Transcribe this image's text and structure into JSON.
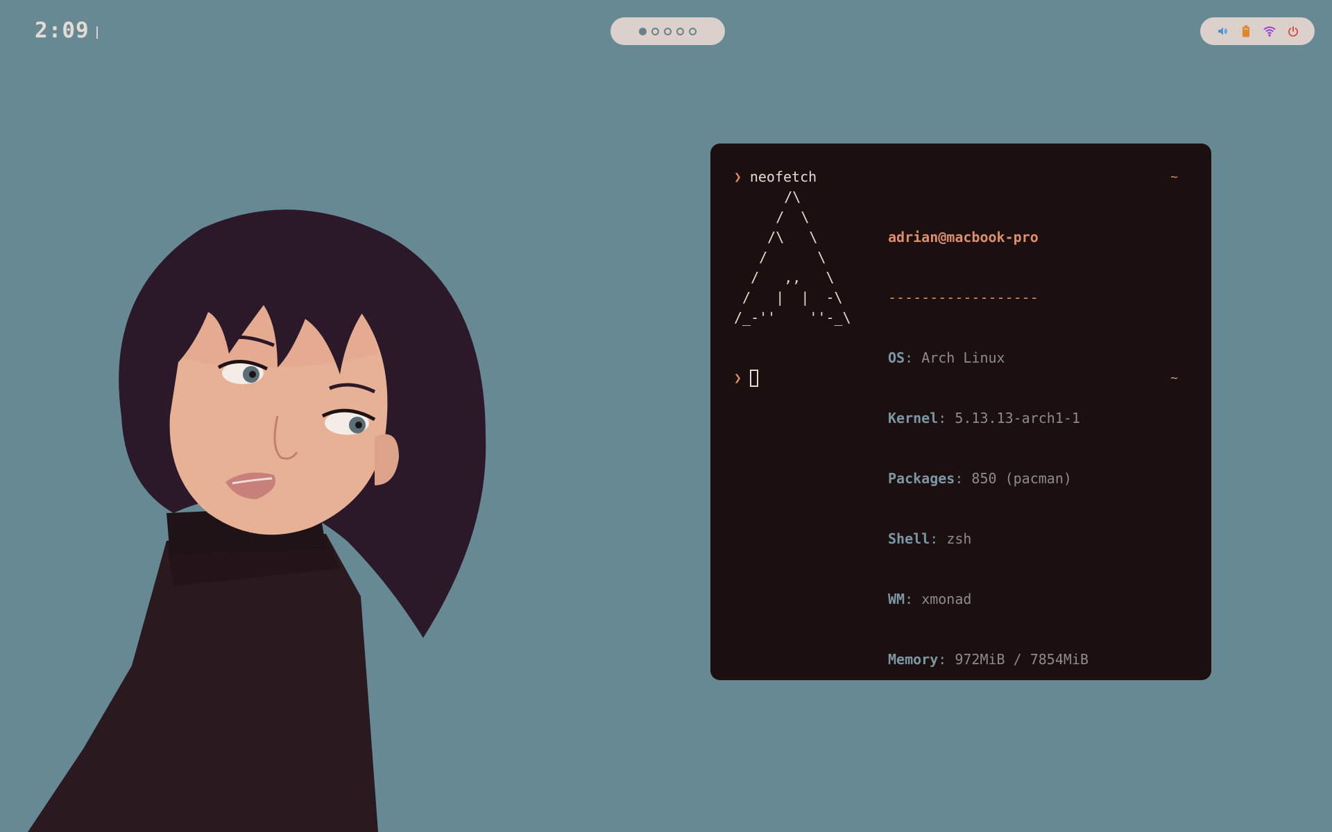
{
  "clock": {
    "time": "2:09"
  },
  "workspaces": {
    "active_index": 0,
    "count": 5
  },
  "tray": {
    "icons": [
      "volume-icon",
      "battery-icon",
      "wifi-icon",
      "power-icon"
    ],
    "colors": {
      "volume": "#4d8fd1",
      "battery": "#e0882e",
      "wifi": "#9a3fc9",
      "power": "#d8483e"
    }
  },
  "terminal": {
    "prompt_symbol": "❯",
    "command": "neofetch",
    "tilde": "~",
    "ascii_logo": "      /\\\n     /  \\\n    /\\   \\\n   /      \\\n  /   ,,   \\\n /   |  |  -\\\n/_-''    ''-_\\",
    "user_host": "adrian@macbook-pro",
    "separator": "------------------",
    "info": [
      {
        "key": "OS",
        "value": "Arch Linux"
      },
      {
        "key": "Kernel",
        "value": "5.13.13-arch1-1"
      },
      {
        "key": "Packages",
        "value": "850 (pacman)"
      },
      {
        "key": "Shell",
        "value": "zsh"
      },
      {
        "key": "WM",
        "value": "xmonad"
      },
      {
        "key": "Memory",
        "value": "972MiB / 7854MiB"
      }
    ]
  },
  "colors": {
    "desktop_bg": "#678994",
    "terminal_bg": "#1c0f10",
    "accent": "#dd8f6b",
    "info_key": "#7c97a4"
  }
}
